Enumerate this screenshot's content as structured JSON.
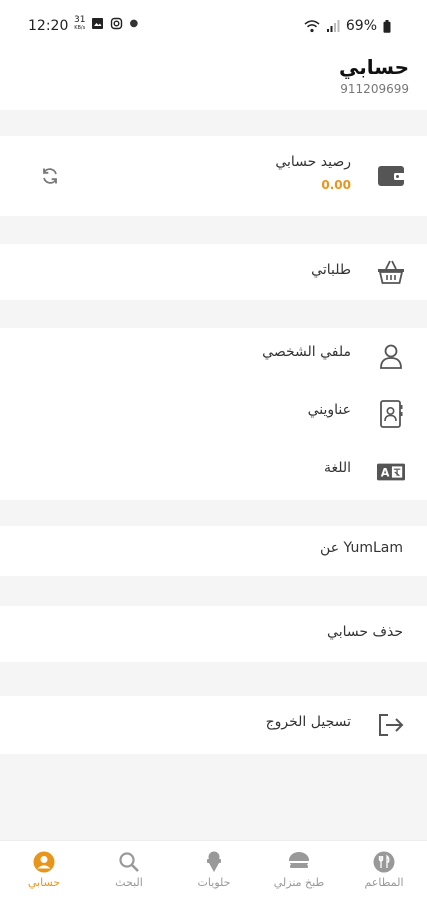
{
  "status_bar": {
    "time": "12:20",
    "date_icon_text": "31",
    "date_icon_sub": "KB/s",
    "battery": "69%"
  },
  "header": {
    "title": "حسابي",
    "phone": "911209699"
  },
  "balance": {
    "label": "رصيد حسابي",
    "amount": "0.00",
    "icon": "wallet-icon",
    "refresh_icon": "refresh-icon"
  },
  "orders": {
    "label": "طلباتي",
    "icon": "basket-icon"
  },
  "profile_section": {
    "items": [
      {
        "label": "ملفي الشخصي",
        "icon": "user-icon"
      },
      {
        "label": "عناويني",
        "icon": "address-book-icon"
      },
      {
        "label": "اللغة",
        "icon": "language-icon"
      }
    ]
  },
  "about": {
    "label": "عن YumLam"
  },
  "delete_account": {
    "label": "حذف حسابي"
  },
  "logout": {
    "label": "تسجيل الخروج",
    "icon": "logout-icon"
  },
  "bottom_nav": {
    "items": [
      {
        "label": "حسابي",
        "icon": "account-icon",
        "active": true
      },
      {
        "label": "البحث",
        "icon": "search-icon",
        "active": false
      },
      {
        "label": "حلويات",
        "icon": "ice-cream-icon",
        "active": false
      },
      {
        "label": "طبخ منزلي",
        "icon": "dish-icon",
        "active": false
      },
      {
        "label": "المطاعم",
        "icon": "restaurant-icon",
        "active": false
      }
    ]
  },
  "colors": {
    "accent": "#e8951c",
    "background": "#f5f5f5",
    "card": "#ffffff",
    "inactive": "#999999"
  }
}
